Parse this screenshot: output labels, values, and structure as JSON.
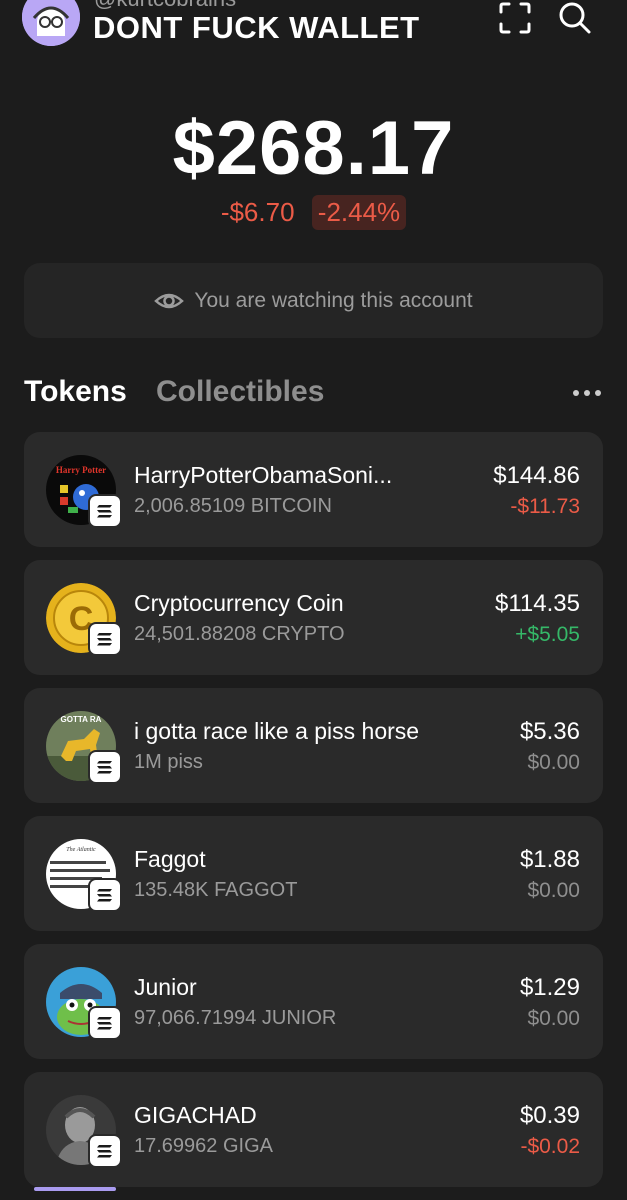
{
  "header": {
    "handle": "@kurtcobrains",
    "wallet_name": "DONT FUCK WALLET"
  },
  "balance": {
    "total": "$268.17",
    "change_value": "-$6.70",
    "change_percent": "-2.44%"
  },
  "watch_banner": {
    "text": "You are watching this account",
    "icon": "eye-icon"
  },
  "tabs": [
    {
      "label": "Tokens",
      "active": true
    },
    {
      "label": "Collectibles",
      "active": false
    }
  ],
  "tokens": [
    {
      "name": "HarryPotterObamaSoni...",
      "amount": "2,006.85109 BITCOIN",
      "value": "$144.86",
      "change": "-$11.73",
      "trend": "neg",
      "logo_text": "Harry Potter"
    },
    {
      "name": "Cryptocurrency Coin",
      "amount": "24,501.88208 CRYPTO",
      "value": "$114.35",
      "change": "+$5.05",
      "trend": "pos",
      "logo_text": "C"
    },
    {
      "name": "i gotta race like a piss horse",
      "amount": "1M piss",
      "value": "$5.36",
      "change": "$0.00",
      "trend": "flat",
      "logo_text": "GOTTA RA"
    },
    {
      "name": "Faggot",
      "amount": "135.48K FAGGOT",
      "value": "$1.88",
      "change": "$0.00",
      "trend": "flat",
      "logo_text": "The Atlantic"
    },
    {
      "name": "Junior",
      "amount": "97,066.71994 JUNIOR",
      "value": "$1.29",
      "change": "$0.00",
      "trend": "flat",
      "logo_text": ""
    },
    {
      "name": "GIGACHAD",
      "amount": "17.69962 GIGA",
      "value": "$0.39",
      "change": "-$0.02",
      "trend": "neg",
      "logo_text": ""
    }
  ],
  "colors": {
    "background": "#1c1c1c",
    "card": "#2a2a2a",
    "negative": "#eb5b47",
    "positive": "#35b868",
    "accent": "#a99bef"
  }
}
